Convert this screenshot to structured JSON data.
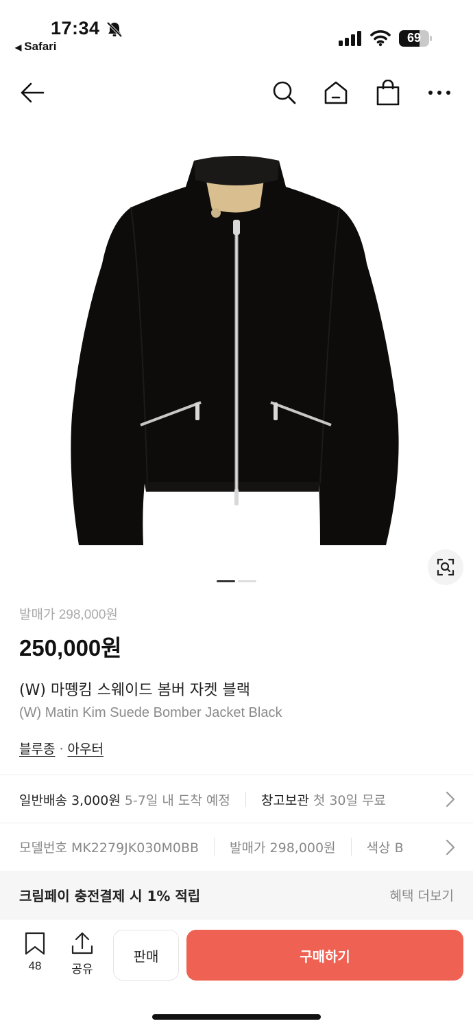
{
  "status_bar": {
    "time": "17:34",
    "back_app": "Safari",
    "battery_level": 69,
    "battery_label": "69"
  },
  "nav": {
    "icons": [
      "back-arrow-icon",
      "search-icon",
      "home-icon",
      "shopping-bag-icon",
      "more-icon"
    ]
  },
  "gallery": {
    "image_count": 2,
    "active_index": 0
  },
  "product": {
    "original_price": "발매가 298,000원",
    "price": "250,000원",
    "name_ko": "(W) 마뗑킴 스웨이드 봄버 자켓 블랙",
    "name_en": "(W) Matin Kim Suede Bomber Jacket Black",
    "categories": [
      "블루종",
      "아우터"
    ],
    "category_separator": "·"
  },
  "shipping": {
    "standard_label": "일반배송 3,000원",
    "standard_eta": "5-7일 내 도착 예정",
    "warehouse_label": "창고보관",
    "warehouse_note": "첫 30일 무료"
  },
  "specs": {
    "model": "모델번호 MK2279JK030M0BB",
    "release_price": "발매가 298,000원",
    "color": "색상 B"
  },
  "benefit": {
    "title": "크림페이 충전결제 시 1% 적립",
    "more": "혜택 더보기"
  },
  "bottom_bar": {
    "bookmark_count": "48",
    "share_label": "공유",
    "sell_label": "판매",
    "buy_label": "구매하기"
  },
  "colors": {
    "accent": "#ef6253",
    "text": "#111111",
    "muted": "#888888"
  }
}
